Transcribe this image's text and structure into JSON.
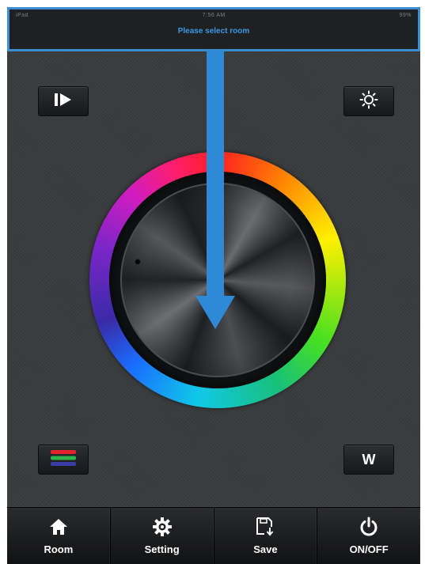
{
  "status_bar": {
    "left": "iPad",
    "center": "7:56 AM",
    "right": "99%"
  },
  "header": {
    "prompt": "Please select room"
  },
  "controls": {
    "play_icon": "skip-play-icon",
    "brightness_icon": "sun-icon",
    "rgb_icon": "rgb-stripes-icon",
    "white_label": "W"
  },
  "tabs": [
    {
      "label": "Room",
      "icon": "home-icon"
    },
    {
      "label": "Setting",
      "icon": "gear-icon"
    },
    {
      "label": "Save",
      "icon": "save-icon"
    },
    {
      "label": "ON/OFF",
      "icon": "power-icon"
    }
  ],
  "colors": {
    "accent": "#3a8fd4",
    "background": "#3a3c3e",
    "tabbar": "#1a1b1d"
  }
}
